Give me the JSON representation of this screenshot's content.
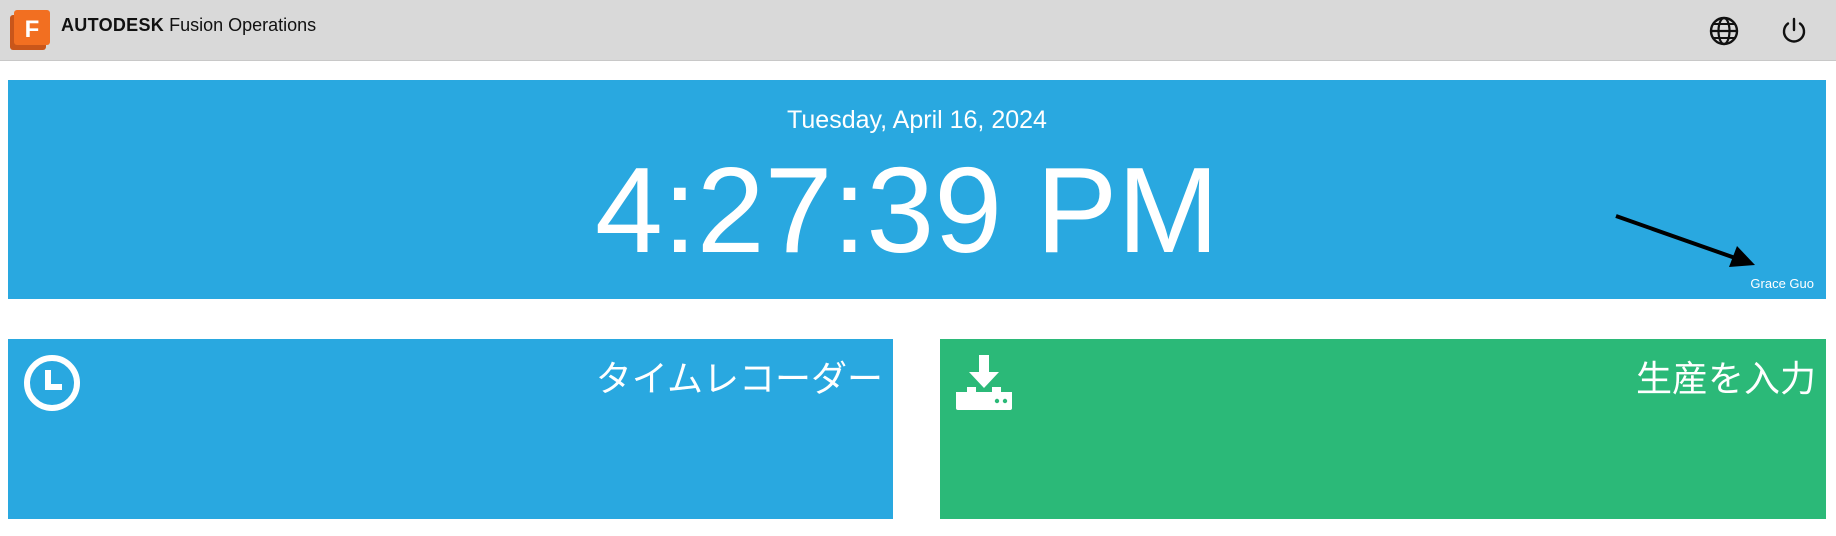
{
  "header": {
    "brand_bold": "AUTODESK",
    "brand_product": "Fusion Operations",
    "logo_letter": "F",
    "icons": [
      "globe-icon",
      "power-icon"
    ]
  },
  "clock": {
    "date": "Tuesday, April 16, 2024",
    "time": "4:27:39 PM",
    "user": "Grace Guo"
  },
  "tiles": [
    {
      "label": "タイムレコーダー",
      "icon": "clock-icon",
      "color": "#29a8e0"
    },
    {
      "label": "生産を入力",
      "icon": "download-tray-icon",
      "color": "#2bb978"
    }
  ],
  "colors": {
    "topbar": "#d9d9d9",
    "accent_blue": "#29a8e0",
    "accent_green": "#2bb978",
    "logo_orange": "#f26f21"
  }
}
